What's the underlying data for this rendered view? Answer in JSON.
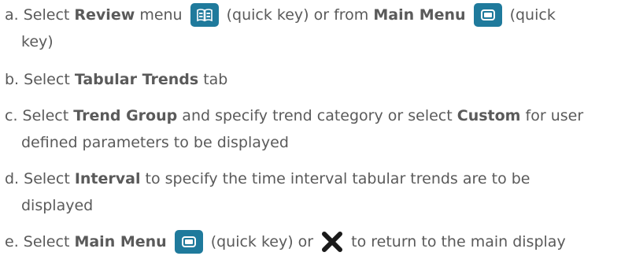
{
  "steps": [
    {
      "marker": "a.",
      "parts": [
        "Select",
        "Review",
        "menu",
        "(quick key) or from",
        "Main Menu",
        "(quick",
        "key)"
      ]
    },
    {
      "marker": "b.",
      "parts": [
        "Select",
        "Tabular Trends",
        "tab"
      ]
    },
    {
      "marker": "c.",
      "parts": [
        "Select",
        "Trend Group",
        "and specify trend category or select",
        "Custom",
        "for user",
        "defined parameters to be displayed"
      ]
    },
    {
      "marker": "d.",
      "parts": [
        "Select",
        "Interval",
        "to specify the time interval tabular trends are to be",
        "displayed"
      ]
    },
    {
      "marker": "e.",
      "parts": [
        "Select",
        "Main Menu",
        "(quick key) or",
        "to return to the main display"
      ]
    }
  ],
  "icons": {
    "review_key": "review-book-icon",
    "main_menu_key": "main-menu-monitor-icon",
    "close": "close-x-icon",
    "key_color": "#1f7a9c",
    "text_color": "#5a5a5a"
  }
}
